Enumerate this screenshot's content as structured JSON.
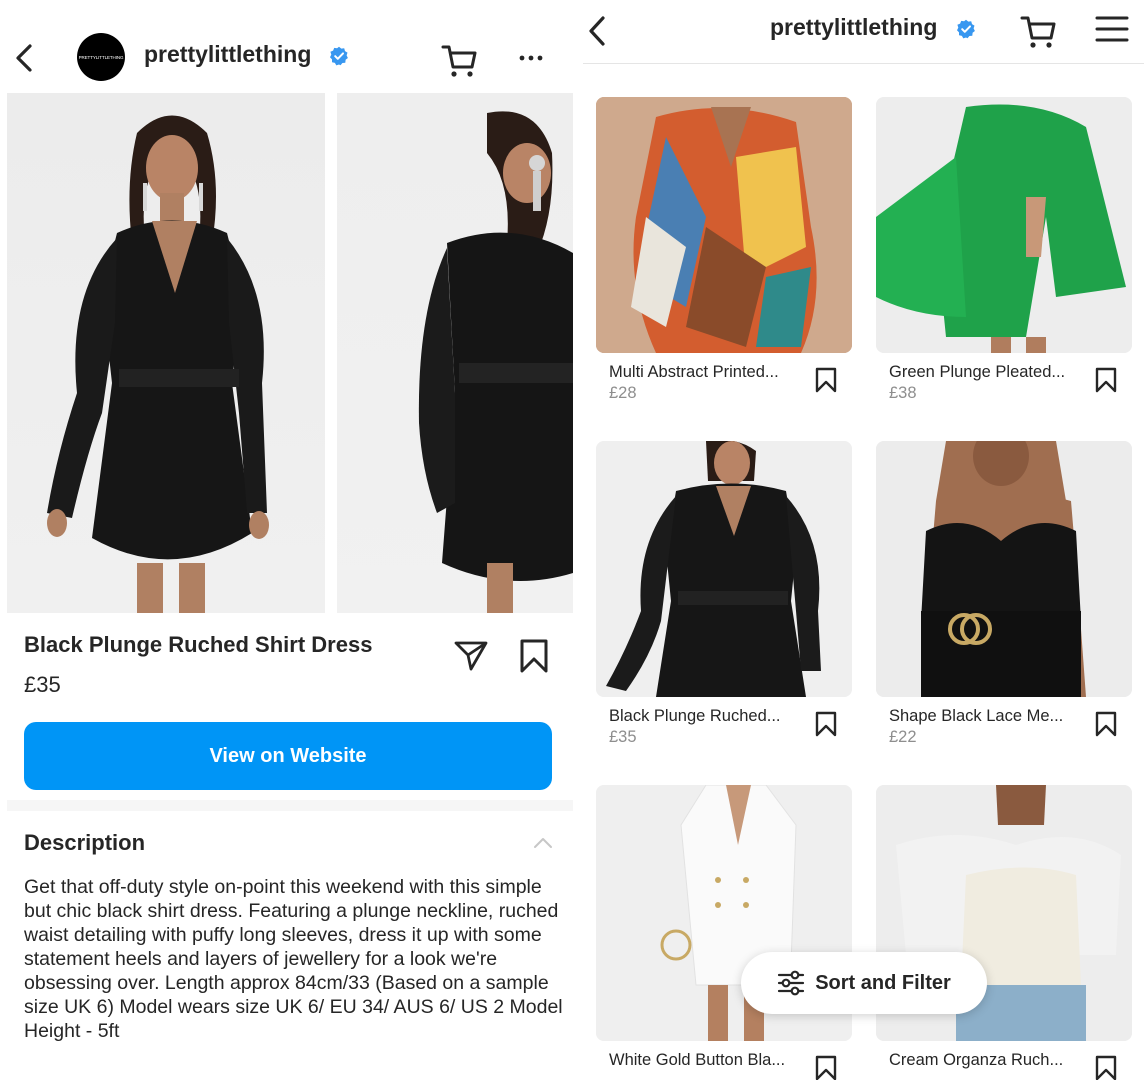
{
  "left": {
    "header": {
      "username": "prettylittlething",
      "avatar_text": "PRETTYLITTLETHING"
    },
    "product": {
      "title": "Black Plunge Ruched Shirt Dress",
      "price": "£35",
      "button_label": "View on Website"
    },
    "description": {
      "heading": "Description",
      "text": "Get that off-duty style on-point this weekend with this simple but chic black shirt dress. Featuring a plunge neckline, ruched waist detailing with puffy long sleeves, dress it up with some statement heels and layers of jewellery for a look we're obsessing over. Length approx 84cm/33 (Based on a sample size UK 6) Model wears size UK 6/ EU 34/ AUS 6/ US 2 Model Height - 5ft"
    }
  },
  "right": {
    "header": {
      "username": "prettylittlething"
    },
    "items": [
      {
        "name": "Multi Abstract Printed...",
        "price": "£28"
      },
      {
        "name": "Green Plunge Pleated...",
        "price": "£38"
      },
      {
        "name": "Black Plunge Ruched...",
        "price": "£35"
      },
      {
        "name": "Shape Black Lace Me...",
        "price": "£22"
      },
      {
        "name": "White Gold Button Bla...",
        "price": ""
      },
      {
        "name": "Cream Organza Ruch...",
        "price": ""
      }
    ],
    "sort_label": "Sort and Filter"
  },
  "colors": {
    "accent_blue": "#0095f6",
    "verified_blue": "#3897f0",
    "text": "#262626",
    "secondary_text": "#8e8e8e"
  }
}
